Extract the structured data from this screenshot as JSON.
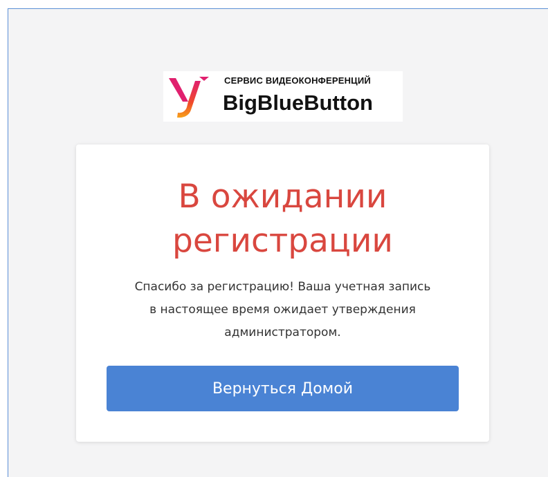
{
  "logo": {
    "subtitle": "СЕРВИС ВИДЕОКОНФЕРЕНЦИЙ",
    "title": "BigBlueButton",
    "icon": "bigbluebutton-logo-icon"
  },
  "card": {
    "heading_line1": "В ожидании",
    "heading_line2": "регистрации",
    "message_line1": "Спасибо за регистрацию! Ваша учетная запись",
    "message_line2": "в настоящее время ожидает утверждения",
    "message_line3": "администратором.",
    "home_button": "Вернуться Домой"
  },
  "colors": {
    "heading": "#d9473f",
    "button": "#4a83d4",
    "background": "#f4f4f5"
  }
}
